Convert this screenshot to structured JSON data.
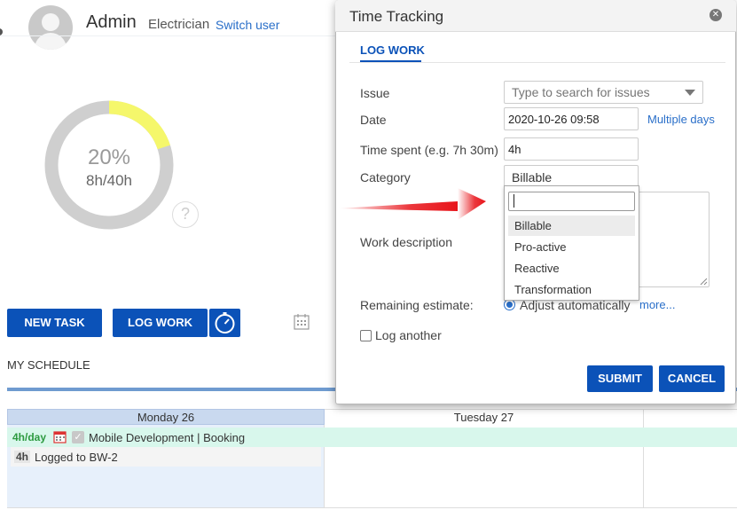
{
  "header": {
    "username": "Admin",
    "role": "Electrician",
    "switch_user": "Switch user"
  },
  "progress": {
    "percent_label": "20%",
    "hours_label": "8h/40h",
    "fraction": 0.2,
    "help": "?"
  },
  "actions": {
    "new_task": "NEW TASK",
    "log_work": "LOG WORK"
  },
  "schedule": {
    "title": "MY SCHEDULE",
    "days": [
      "Monday 26",
      "Tuesday 27"
    ],
    "event": {
      "per_day": "4h/day",
      "title": "Mobile Development | Booking"
    },
    "log": {
      "hours": "4h",
      "text": "Logged to BW-2"
    }
  },
  "dialog": {
    "title": "Time Tracking",
    "tab": "LOG WORK",
    "labels": {
      "issue": "Issue",
      "date": "Date",
      "time_spent": "Time spent (e.g. 7h 30m)",
      "category": "Category",
      "work_description": "Work description",
      "remaining_estimate": "Remaining estimate:"
    },
    "issue_placeholder": "Type to search for issues",
    "date_value": "2020-10-26 09:58",
    "multiple_days": "Multiple days",
    "time_value": "4h",
    "category_value": "Billable",
    "category_options": [
      "Billable",
      "Pro-active",
      "Reactive",
      "Transformation"
    ],
    "remaining_option": "Adjust automatically",
    "more": "more...",
    "log_another": "Log another",
    "submit": "SUBMIT",
    "cancel": "CANCEL"
  },
  "colors": {
    "primary": "#0b52b8",
    "progress_fill": "#f5f76b",
    "progress_track": "#cfcfcf",
    "arrow": "#e8141a",
    "event_bg": "#d8f7ec"
  },
  "icons": [
    "avatar-icon",
    "help-icon",
    "timer-icon",
    "calendar-icon",
    "close-icon",
    "chevron-down-icon",
    "check-icon",
    "resize-grip-icon"
  ]
}
